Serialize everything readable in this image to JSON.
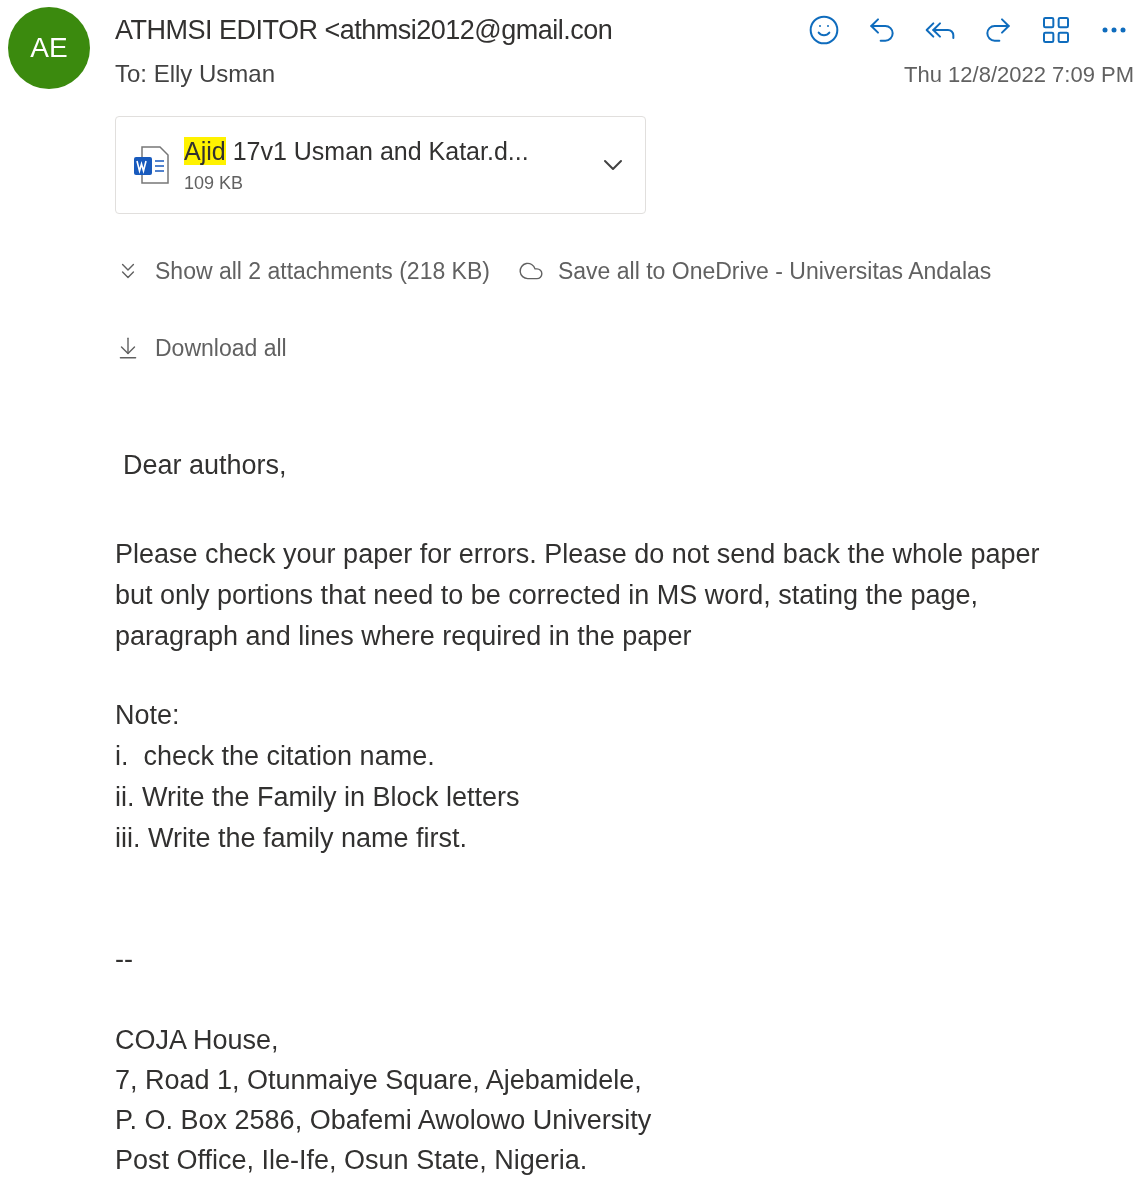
{
  "sender": {
    "initials": "AE",
    "name": "ATHMSI EDITOR <athmsi2012@gmail.con"
  },
  "toolbar": [
    {
      "kind": "emoji"
    },
    {
      "kind": "reply"
    },
    {
      "kind": "reply_all"
    },
    {
      "kind": "forward"
    },
    {
      "kind": "apps"
    },
    {
      "kind": "more"
    }
  ],
  "recipients": {
    "label": "To:",
    "name": "Elly Usman"
  },
  "date": "Thu 12/8/2022 7:09 PM",
  "attachment": {
    "name": "**Ajid** 17v1 Usman and Katar.d...",
    "size": "109 KB"
  },
  "attachment_actions": [
    {
      "kind": "show_all",
      "label": "Show all 2 attachments (218 KB)"
    },
    {
      "kind": "onedrive",
      "label": "Save all to OneDrive - Universitas Andalas"
    },
    {
      "kind": "download",
      "label": "Download all"
    }
  ],
  "body": {
    "greeting": "Dear authors,",
    "paragraph": "Please check your paper for errors. Please do not send back the whole paper but only portions that need to be corrected in MS word, stating the page, paragraph and lines where required in the paper",
    "note_title": "Note:",
    "notes": [
      "i.  check the citation name.",
      "ii. Write the Family in Block letters",
      "iii. Write the family name first."
    ],
    "separator": "--",
    "signature": [
      "COJA House,",
      "7, Road 1, Otunmaiye Square, Ajebamidele,",
      "P. O. Box 2586, Obafemi Awolowo University",
      "Post Office, Ile-Ife, Osun State, Nigeria."
    ]
  }
}
